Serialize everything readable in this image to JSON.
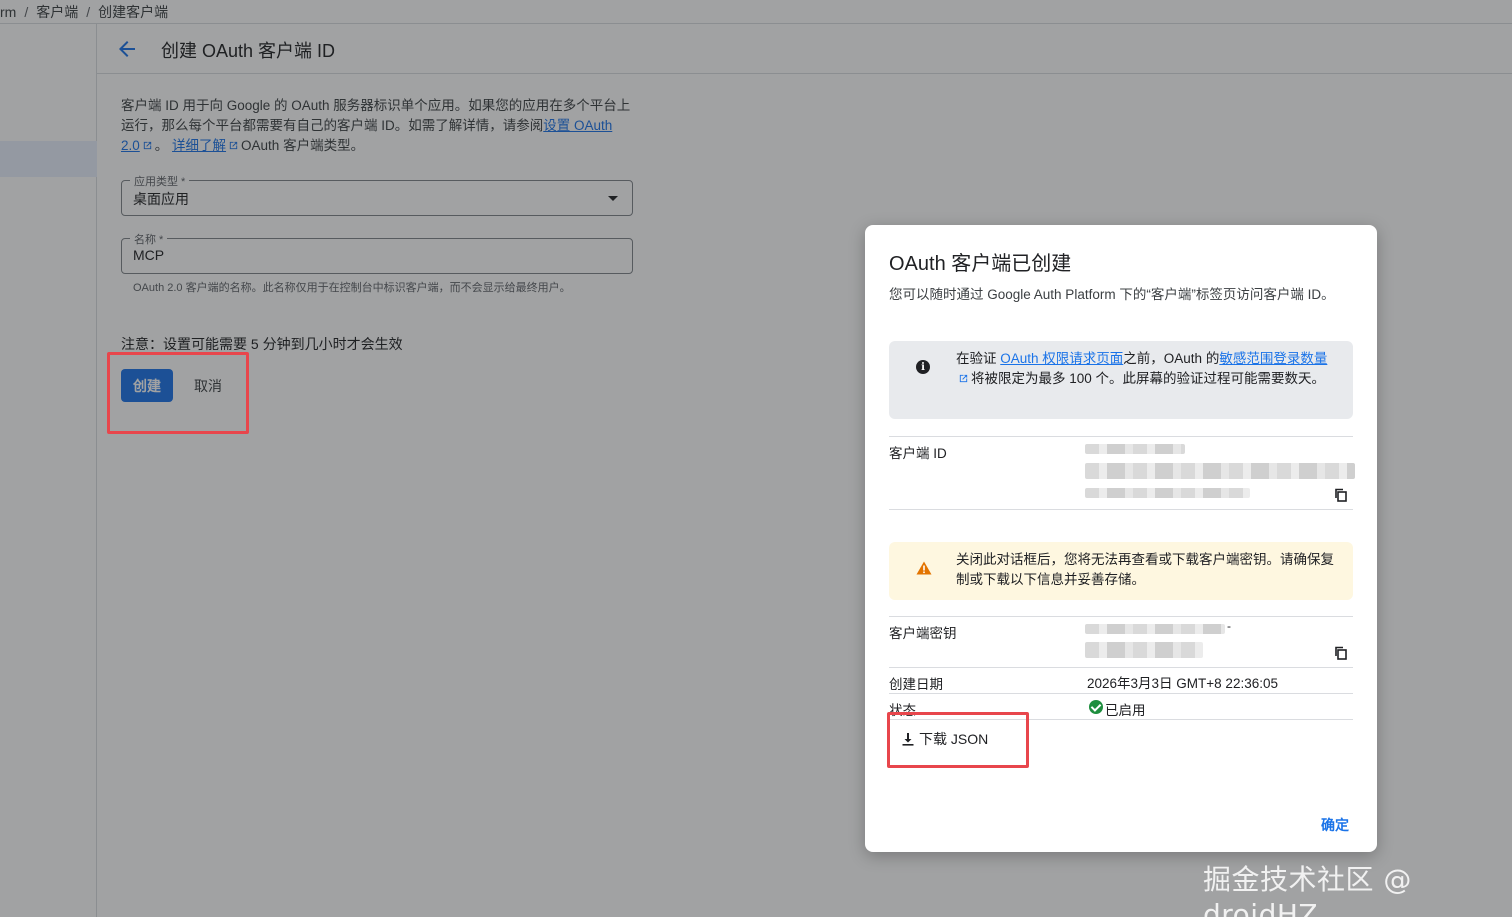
{
  "breadcrumb": [
    "rm",
    "客户端",
    "创建客户端"
  ],
  "breadcrumb_sep": "/",
  "page": {
    "title": "创建 OAuth 客户端 ID",
    "desc_1": "客户端 ID 用于向 Google 的 OAuth 服务器标识单个应用。如果您的应用在多个平台上运行，那么每个平台都需要有自己的客户端 ID。如需了解详情，请参阅",
    "desc_link_1": "设置 OAuth 2.0",
    "desc_2": "。",
    "desc_link_2": "详细了解",
    "desc_3": "OAuth 客户端类型。",
    "app_type_label": "应用类型 *",
    "app_type_value": "桌面应用",
    "name_label": "名称 *",
    "name_value": "MCP",
    "name_helper": "OAuth 2.0 客户端的名称。此名称仅用于在控制台中标识客户端，而不会显示给最终用户。",
    "note": "注意：设置可能需要 5 分钟到几小时才会生效",
    "create_label": "创建",
    "cancel_label": "取消"
  },
  "dialog": {
    "title": "OAuth 客户端已创建",
    "subtitle": "您可以随时通过 Google Auth Platform 下的“客户端”标签页访问客户端 ID。",
    "info_1": "在验证 ",
    "info_link_1": "OAuth 权限请求页面",
    "info_2": "之前，OAuth 的",
    "info_link_2": "敏感范围登录数量",
    "info_3": "将被限定为最多 100 个。此屏幕的验证过程可能需要数天。",
    "client_id_label": "客户端 ID",
    "warning": "关闭此对话框后，您将无法再查看或下载客户端密钥。请确保复制或下载以下信息并妥善存储。",
    "secret_label": "客户端密钥",
    "secret_fragment": "-",
    "created_label": "创建日期",
    "created_value": "2026年3月3日 GMT+8 22:36:05",
    "status_label": "状态",
    "status_value": "已启用",
    "download_label": "下载 JSON",
    "ok_label": "确定"
  },
  "watermark": "掘金技术社区 @ droidHZ",
  "colors": {
    "accent": "#1a73e8",
    "highlight": "#e8464c",
    "status_ok": "#1e8e3e",
    "warning": "#e37400"
  }
}
